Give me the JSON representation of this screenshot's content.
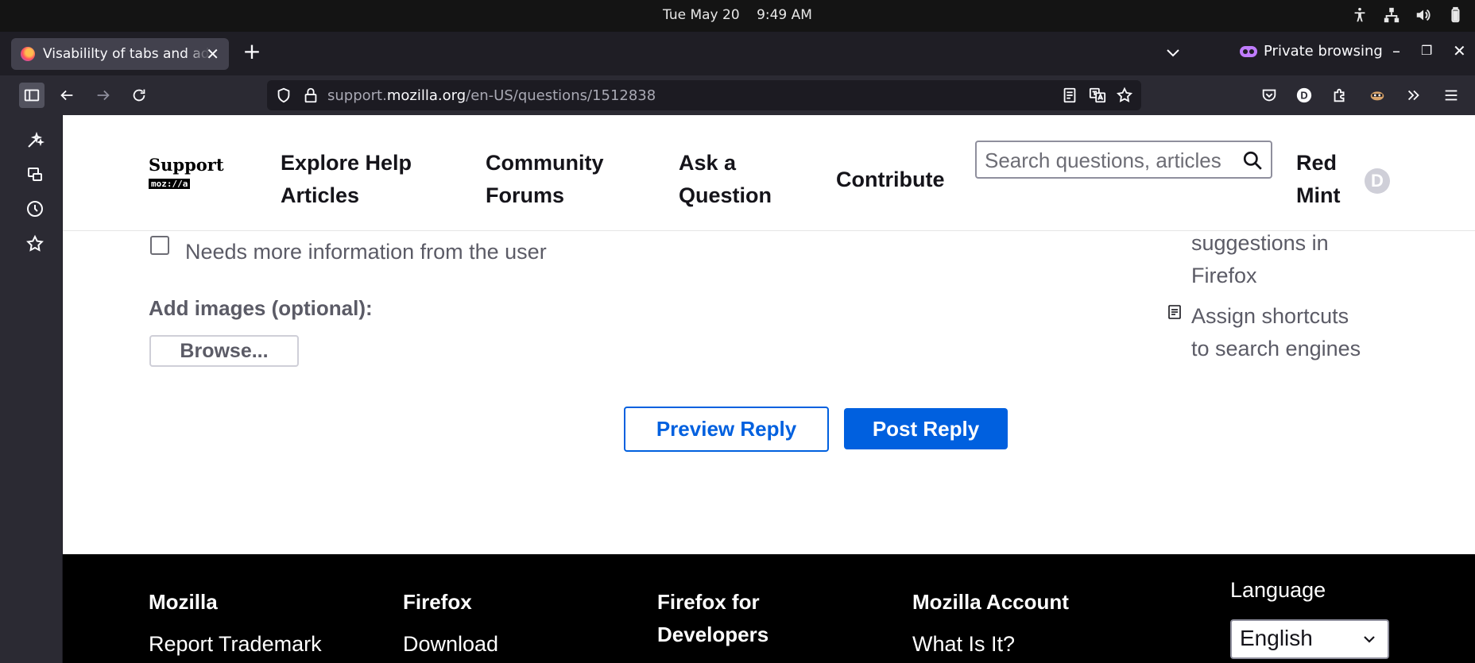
{
  "system": {
    "date": "Tue May 20",
    "time": "9:49 AM"
  },
  "browser": {
    "tab_title": "Visabililty of tabs and add",
    "private_label": "Private browsing",
    "url_domain_prefix": "support.",
    "url_domain": "mozilla.org",
    "url_path": "/en-US/questions/1512838"
  },
  "header": {
    "logo_text": "Support",
    "logo_badge": "moz://a",
    "nav": [
      {
        "label": "Explore Help\nArticles"
      },
      {
        "label": "Community\nForums"
      },
      {
        "label": "Ask a\nQuestion"
      },
      {
        "label": "Contribute"
      }
    ],
    "search_placeholder": "Search questions, articles",
    "user_name": "Red\nMint",
    "avatar_letter": "D"
  },
  "form": {
    "checkbox_label": "Needs more information from the user",
    "add_images_label": "Add images (optional):",
    "browse_label": "Browse...",
    "preview_label": "Preview Reply",
    "post_label": "Post Reply"
  },
  "sidebar_related": {
    "partial_text": "suggestions in\nFirefox",
    "article_label": "Assign shortcuts\nto search engines"
  },
  "footer": {
    "columns": [
      {
        "heading": "Mozilla",
        "link": "Report Trademark"
      },
      {
        "heading": "Firefox",
        "link": "Download"
      },
      {
        "heading": "Firefox for\nDevelopers",
        "link": ""
      },
      {
        "heading": "Mozilla Account",
        "link": "What Is It?"
      }
    ],
    "language_label": "Language",
    "language_value": "English"
  }
}
